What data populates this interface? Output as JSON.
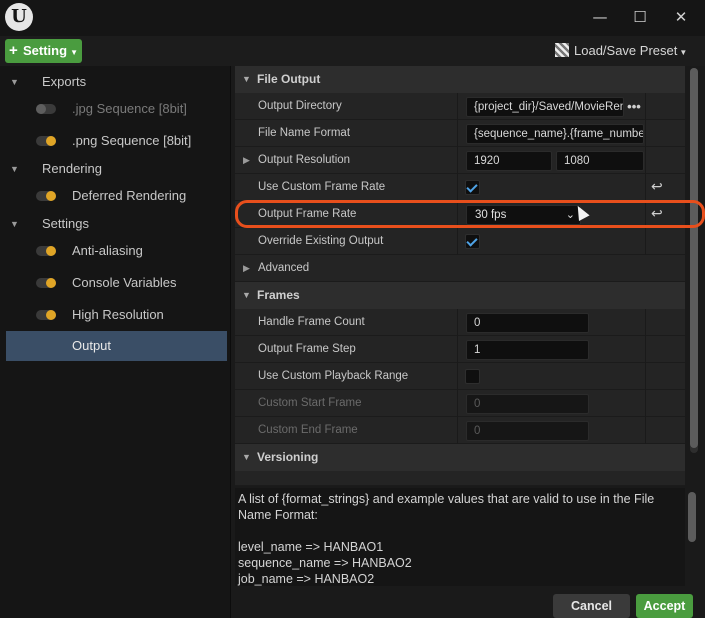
{
  "window": {
    "logo_letter": "U",
    "minimize_icon": "—",
    "maximize_icon": "☐",
    "close_icon": "✕"
  },
  "toolbar": {
    "setting_label": "Setting",
    "preset_label": "Load/Save Preset"
  },
  "sidebar": {
    "categories": [
      {
        "label": "Exports"
      },
      {
        "label": "Rendering"
      },
      {
        "label": "Settings"
      }
    ],
    "items": [
      {
        "label": ".jpg Sequence [8bit]",
        "enabled": false
      },
      {
        "label": ".png Sequence [8bit]",
        "enabled": true
      },
      {
        "label": "Deferred Rendering",
        "enabled": true
      },
      {
        "label": "Anti-aliasing",
        "enabled": true
      },
      {
        "label": "Console Variables",
        "enabled": true
      },
      {
        "label": "High Resolution",
        "enabled": true
      },
      {
        "label": "Output",
        "selected": true
      }
    ]
  },
  "details": {
    "file_output": {
      "header": "File Output",
      "output_directory_label": "Output Directory",
      "output_directory_value": "{project_dir}/Saved/MovieRenders/",
      "file_name_format_label": "File Name Format",
      "file_name_format_value": "{sequence_name}.{frame_number}",
      "output_resolution_label": "Output Resolution",
      "resolution_width": "1920",
      "resolution_height": "1080",
      "use_custom_frame_rate_label": "Use Custom Frame Rate",
      "use_custom_frame_rate": true,
      "output_frame_rate_label": "Output Frame Rate",
      "output_frame_rate_value": "30 fps",
      "override_existing_output_label": "Override Existing Output",
      "override_existing_output": true,
      "advanced_label": "Advanced"
    },
    "frames": {
      "header": "Frames",
      "handle_frame_count_label": "Handle Frame Count",
      "handle_frame_count": "0",
      "output_frame_step_label": "Output Frame Step",
      "output_frame_step": "1",
      "use_custom_playback_range_label": "Use Custom Playback Range",
      "use_custom_playback_range": false,
      "custom_start_frame_label": "Custom Start Frame",
      "custom_start_frame": "0",
      "custom_end_frame_label": "Custom End Frame",
      "custom_end_frame": "0"
    },
    "versioning": {
      "header": "Versioning"
    },
    "ellipsis_label": "•••"
  },
  "description": {
    "text": "A list of {format_strings} and example values that are valid to use in the File Name Format:\n\nlevel_name => HANBAO1\nsequence_name => HANBAO2\njob_name => HANBAO2"
  },
  "footer": {
    "cancel_label": "Cancel",
    "accept_label": "Accept"
  },
  "colors": {
    "accent_green": "#4a9c3f",
    "highlight_orange": "#e84f1c",
    "toggle_on": "#e0a526",
    "checkbox_tick": "#4fa3e6",
    "selected_row": "#3a4e66"
  }
}
